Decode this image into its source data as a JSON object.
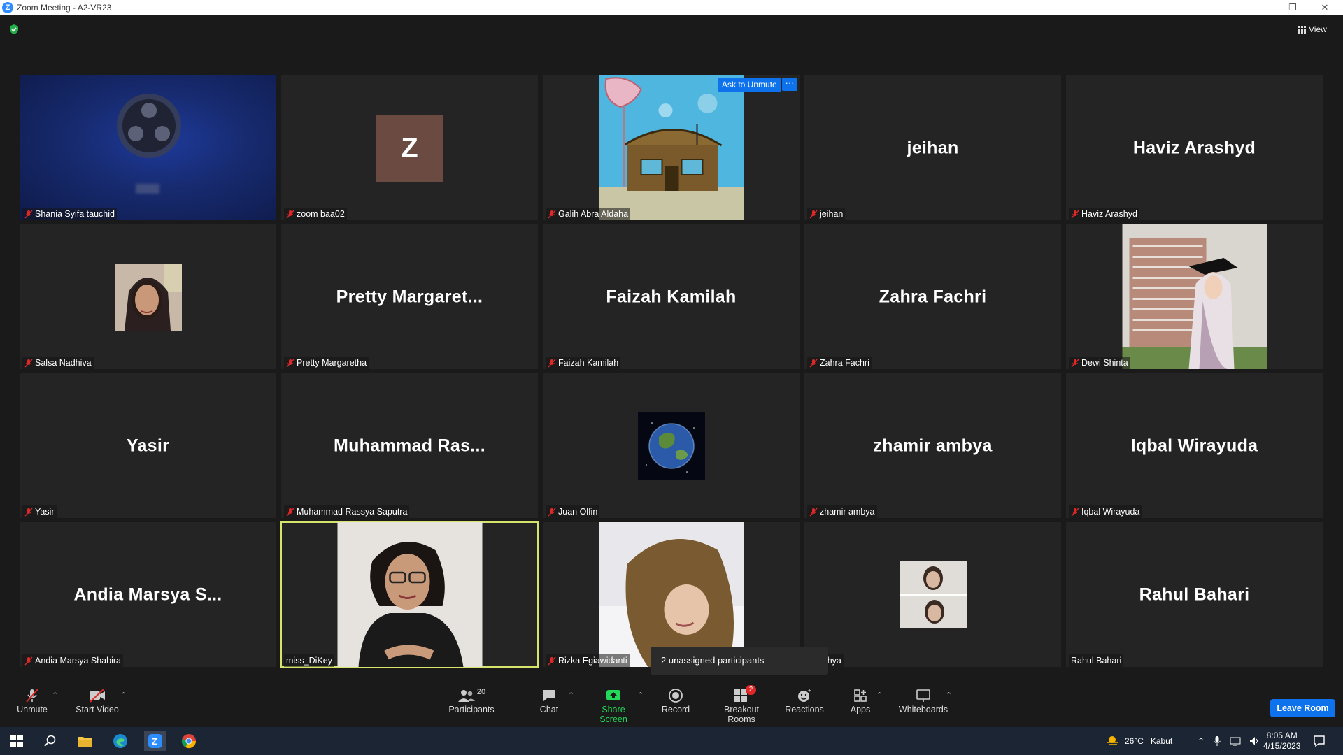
{
  "window": {
    "title": "Zoom Meeting - A2-VR23",
    "app_logo": "Z"
  },
  "view_button": {
    "label": "View"
  },
  "tiles": [
    {
      "label": "Shania Syifa tauchid",
      "big": "",
      "type": "obs",
      "muted": true
    },
    {
      "label": "zoom baa02",
      "big": "",
      "type": "z-avatar",
      "avatar_letter": "Z",
      "muted": true
    },
    {
      "label": "Galih Abra Aldaha",
      "big": "",
      "type": "krusty",
      "muted": true
    },
    {
      "label": "jeihan",
      "big": "jeihan",
      "type": "name",
      "muted": true
    },
    {
      "label": "Haviz Arashyd",
      "big": "Haviz Arashyd",
      "type": "name",
      "muted": true
    },
    {
      "label": "Salsa Nadhiva",
      "big": "",
      "type": "photo-small",
      "muted": true
    },
    {
      "label": "Pretty Margaretha",
      "big": "Pretty  Margaret...",
      "type": "name",
      "muted": true
    },
    {
      "label": "Faizah Kamilah",
      "big": "Faizah Kamilah",
      "type": "name",
      "muted": true
    },
    {
      "label": "Zahra Fachri",
      "big": "Zahra Fachri",
      "type": "name",
      "muted": true
    },
    {
      "label": "Dewi Shinta",
      "big": "",
      "type": "grad-photo",
      "muted": true
    },
    {
      "label": "Yasir",
      "big": "Yasir",
      "type": "name",
      "muted": true
    },
    {
      "label": "Muhammad Rassya Saputra",
      "big": "Muhammad  Ras...",
      "type": "name",
      "muted": true
    },
    {
      "label": "Juan Olfin",
      "big": "",
      "type": "earth",
      "muted": true
    },
    {
      "label": "zhamir ambya",
      "big": "zhamir ambya",
      "type": "name",
      "muted": true
    },
    {
      "label": "Iqbal Wirayuda",
      "big": "Iqbal Wirayuda",
      "type": "name",
      "muted": true
    },
    {
      "label": "Andia Marsya Shabira",
      "big": "Andia  Marsya  S...",
      "type": "name",
      "muted": true
    },
    {
      "label": "miss_DiKey",
      "big": "",
      "type": "video",
      "muted": false,
      "active": true
    },
    {
      "label": "Rizka Egiawidanti",
      "big": "",
      "type": "hijab-photo",
      "muted": true
    },
    {
      "label": "is cahya",
      "big": "",
      "type": "two-photo",
      "muted": false
    },
    {
      "label": "Rahul Bahari",
      "big": "Rahul Bahari",
      "type": "name",
      "muted": false
    }
  ],
  "overlay": {
    "ask_to_unmute": "Ask to Unmute",
    "more": "···"
  },
  "tooltip": {
    "text": "2 unassigned participants"
  },
  "toolbar": {
    "unmute": "Unmute",
    "start_video": "Start Video",
    "participants": "Participants",
    "participants_count": "20",
    "chat": "Chat",
    "share_screen": "Share Screen",
    "record": "Record",
    "breakout_rooms": "Breakout Rooms",
    "breakout_badge": "2",
    "reactions": "Reactions",
    "apps": "Apps",
    "whiteboards": "Whiteboards",
    "leave": "Leave Room"
  },
  "taskbar": {
    "weather_temp": "26°C",
    "weather_desc": "Kabut",
    "time": "8:05 AM",
    "date": "4/15/2023"
  },
  "colors": {
    "accent": "#0e72ed",
    "active_border": "#d6e46b",
    "muted_red": "#e02828",
    "share_green": "#23d959"
  }
}
